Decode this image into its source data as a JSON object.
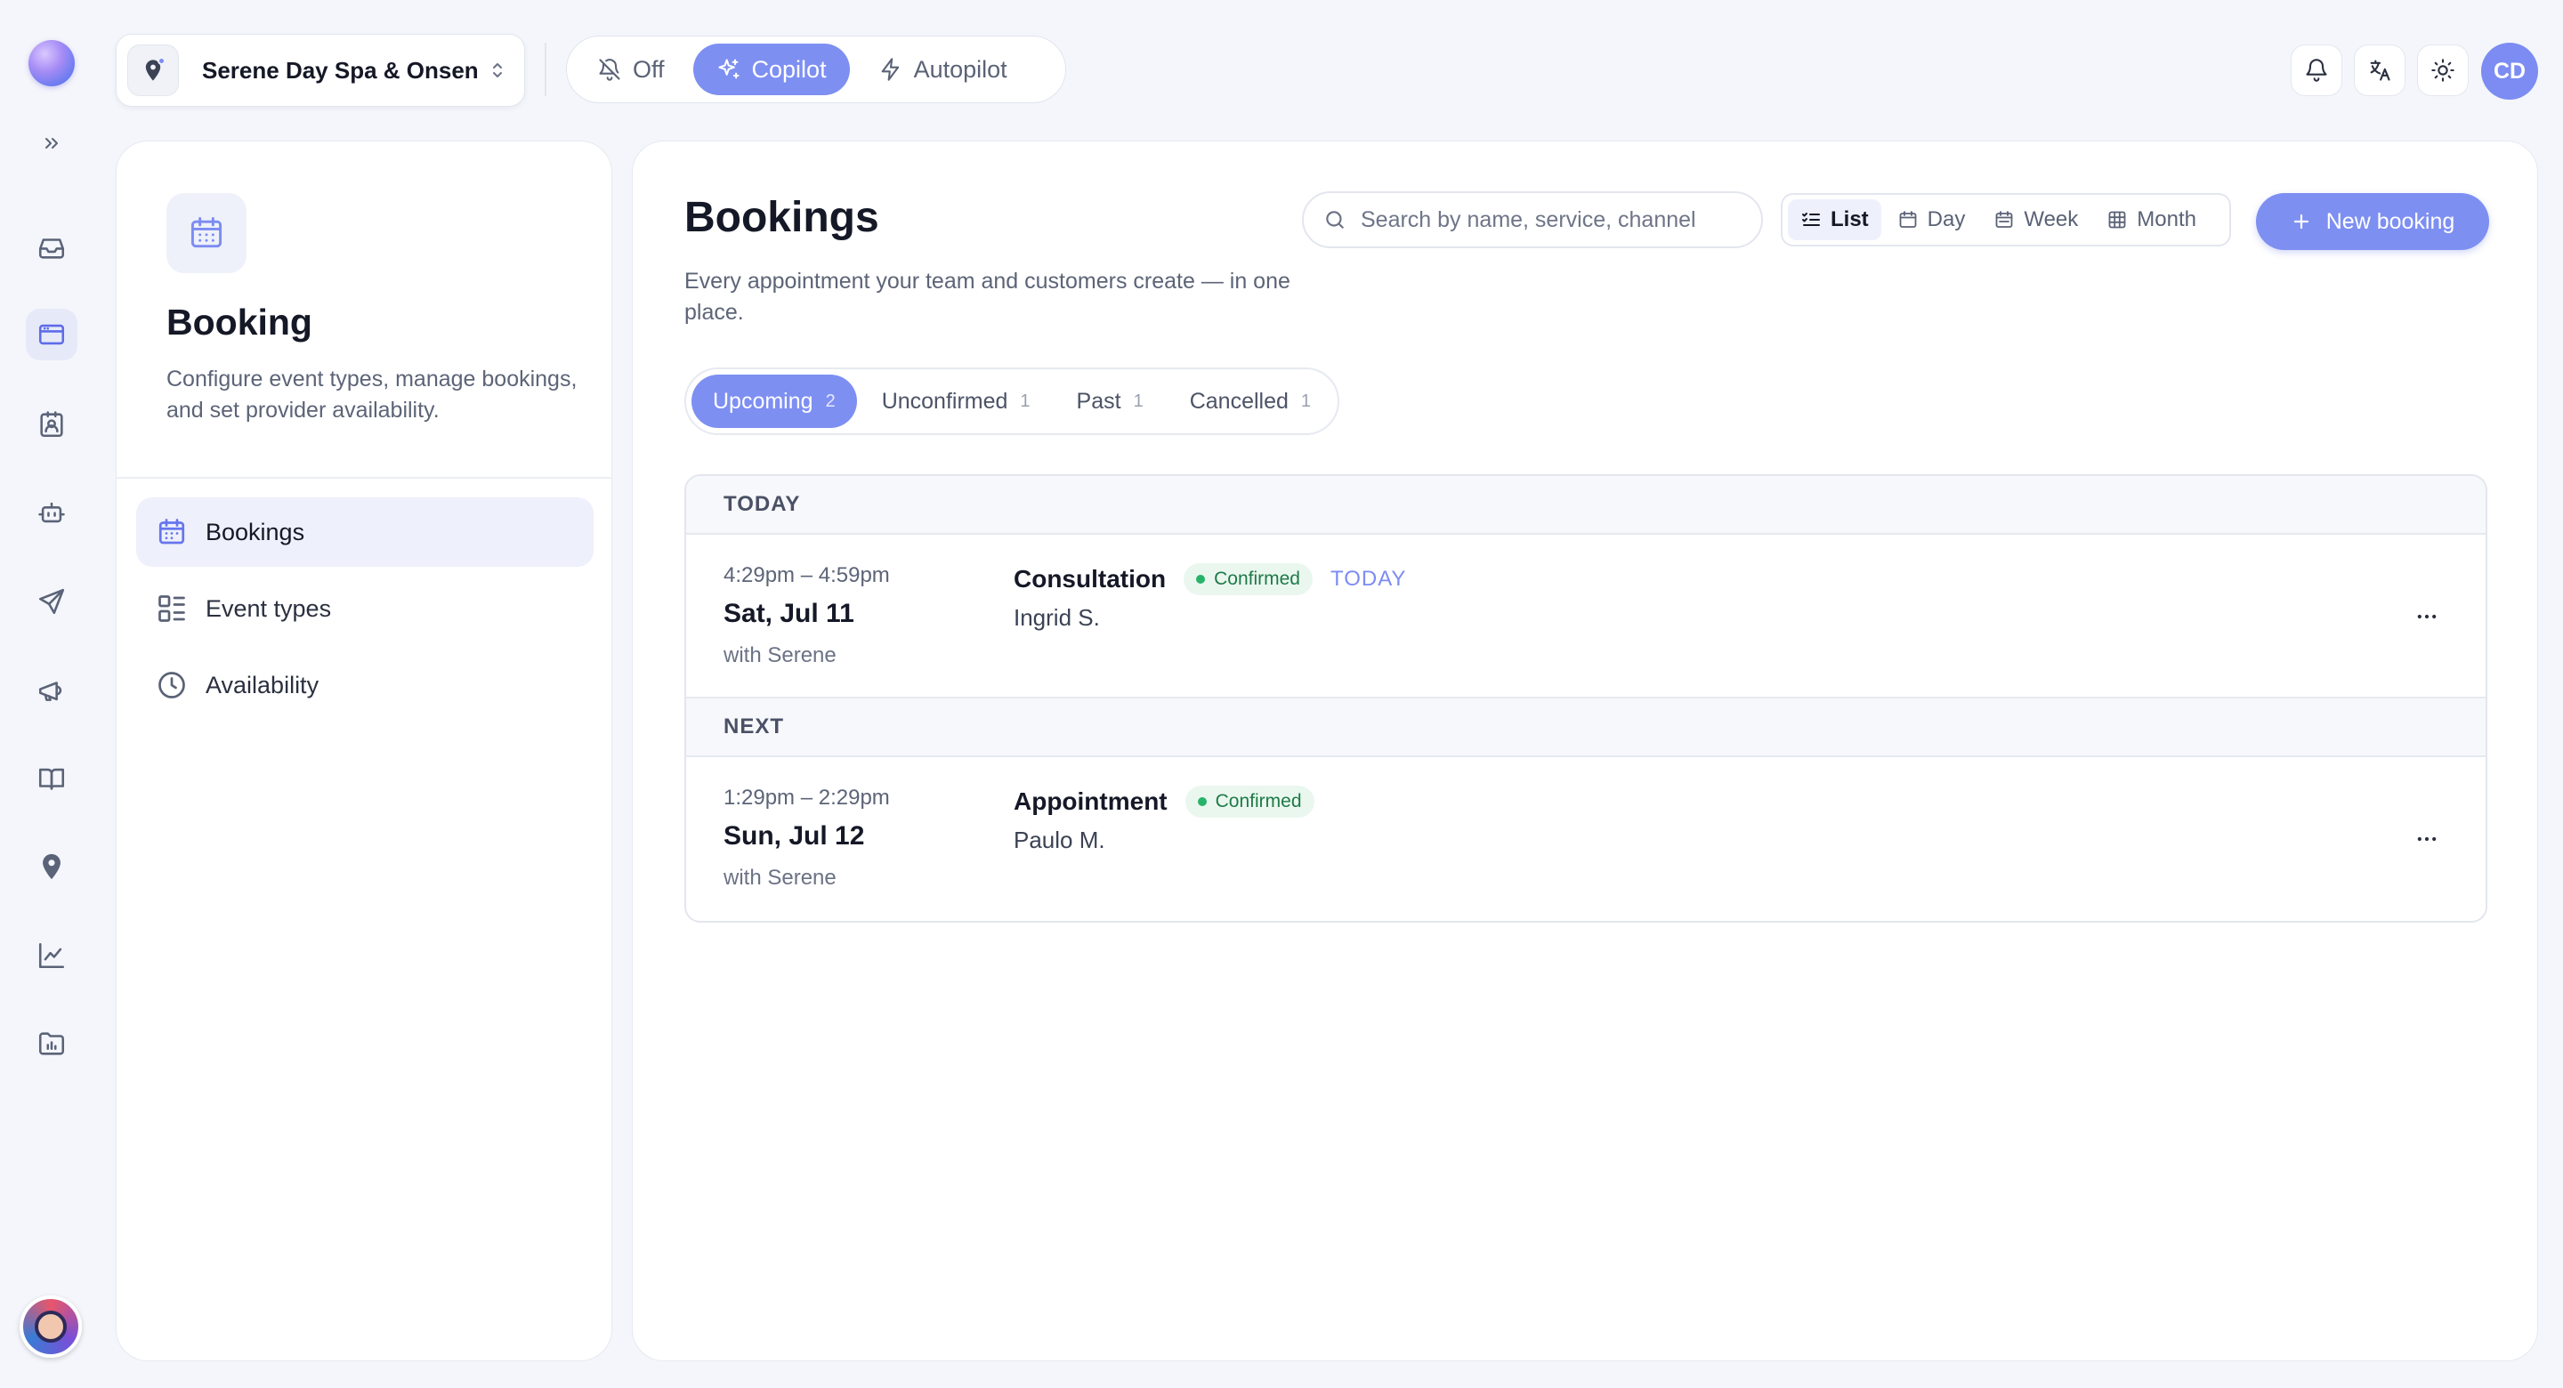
{
  "workspace": {
    "name": "Serene Day Spa & Onsen"
  },
  "modes": [
    {
      "label": "Off",
      "icon": "bell-off-icon",
      "active": false
    },
    {
      "label": "Copilot",
      "icon": "sparkles-icon",
      "active": true
    },
    {
      "label": "Autopilot",
      "icon": "zap-icon",
      "active": false
    }
  ],
  "user": {
    "initials": "CD"
  },
  "sidebar": {
    "title": "Booking",
    "description": "Configure event types, manage bookings, and set provider availability.",
    "items": [
      {
        "label": "Bookings",
        "icon": "calendar-icon",
        "active": true
      },
      {
        "label": "Event types",
        "icon": "layout-list-icon",
        "active": false
      },
      {
        "label": "Availability",
        "icon": "clock-icon",
        "active": false
      }
    ]
  },
  "main": {
    "title": "Bookings",
    "subtitle": "Every appointment your team and customers create — in one place.",
    "search_placeholder": "Search by name, service, channel",
    "views": [
      {
        "label": "List",
        "active": true
      },
      {
        "label": "Day",
        "active": false
      },
      {
        "label": "Week",
        "active": false
      },
      {
        "label": "Month",
        "active": false
      }
    ],
    "new_button": "New booking",
    "tabs": [
      {
        "label": "Upcoming",
        "count": "2",
        "active": true
      },
      {
        "label": "Unconfirmed",
        "count": "1",
        "active": false
      },
      {
        "label": "Past",
        "count": "1",
        "active": false
      },
      {
        "label": "Cancelled",
        "count": "1",
        "active": false
      }
    ],
    "groups": [
      {
        "heading": "TODAY",
        "bookings": [
          {
            "time": "4:29pm – 4:59pm",
            "date": "Sat, Jul 11",
            "with": "with Serene",
            "service": "Consultation",
            "status": "Confirmed",
            "tag": "TODAY",
            "customer": "Ingrid S."
          }
        ]
      },
      {
        "heading": "NEXT",
        "bookings": [
          {
            "time": "1:29pm – 2:29pm",
            "date": "Sun, Jul 12",
            "with": "with Serene",
            "service": "Appointment",
            "status": "Confirmed",
            "tag": "",
            "customer": "Paulo M."
          }
        ]
      }
    ]
  },
  "colors": {
    "accent": "#7e8ff2",
    "confirmed": "#27b36a",
    "background": "#f4f6fb"
  }
}
